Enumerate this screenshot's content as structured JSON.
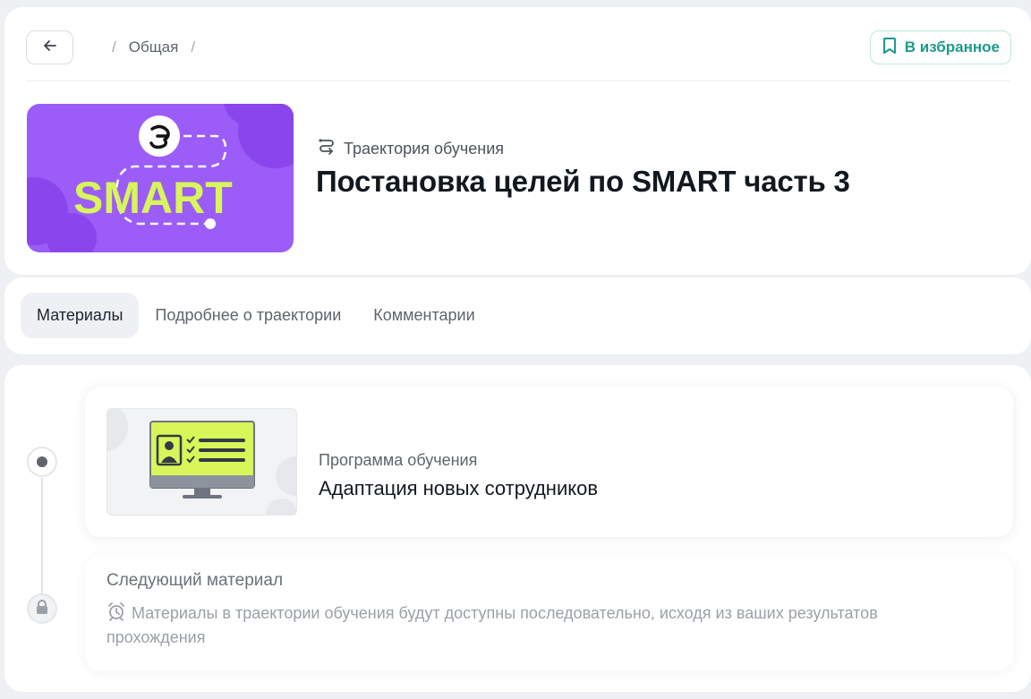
{
  "header": {
    "breadcrumb": [
      "Общая"
    ],
    "favorite_label": "В избранное",
    "type_label": "Траектория обучения",
    "title": "Постановка целей по SMART часть 3",
    "cover_text": "SMART"
  },
  "tabs": [
    {
      "label": "Материалы",
      "active": true
    },
    {
      "label": "Подробнее о траектории",
      "active": false
    },
    {
      "label": "Комментарии",
      "active": false
    }
  ],
  "materials": [
    {
      "type": "Программа обучения",
      "title": "Адаптация новых сотрудников",
      "status": "current"
    }
  ],
  "next": {
    "title": "Следующий материал",
    "note": "Материалы в траектории обучения будут доступны последовательно, исходя из ваших результатов прохождения"
  },
  "colors": {
    "accent": "#1d9a8a",
    "cover_bg": "#9b5cf7",
    "cover_text": "#d8f55a",
    "tab_active_bg": "#eef0f4"
  },
  "icons": {
    "back": "arrow-left-icon",
    "favorite": "bookmark-icon",
    "type": "route-icon",
    "timeline_current": "dot-icon",
    "timeline_locked": "lock-icon",
    "next_note": "alarm-clock-icon"
  }
}
